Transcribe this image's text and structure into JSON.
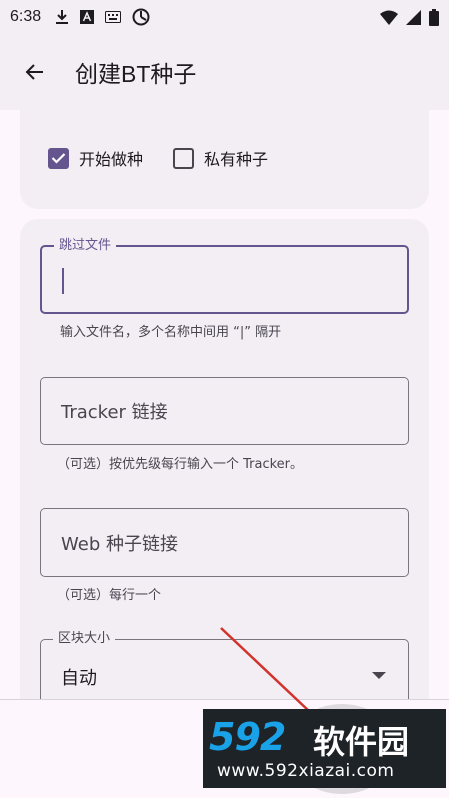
{
  "status_bar": {
    "time": "6:38",
    "left_icons": [
      "download-icon",
      "a-box-icon",
      "keyboard-icon",
      "data-saver-icon"
    ],
    "right_icons": [
      "wifi-icon",
      "signal-icon",
      "battery-icon"
    ]
  },
  "app_bar": {
    "title": "创建BT种子",
    "back_icon": "arrow-back-icon"
  },
  "options": {
    "start_seeding": {
      "label": "开始做种",
      "checked": true
    },
    "private_torrent": {
      "label": "私有种子",
      "checked": false
    }
  },
  "fields": {
    "skip_files": {
      "label": "跳过文件",
      "value": "",
      "helper": "输入文件名，多个名称中间用 “|” 隔开"
    },
    "tracker": {
      "placeholder": "Tracker 链接",
      "helper": "（可选）按优先级每行输入一个 Tracker。"
    },
    "web_seed": {
      "placeholder": "Web 种子链接",
      "helper": "（可选）每行一个"
    },
    "piece_size": {
      "label": "区块大小",
      "value": "自动"
    }
  },
  "watermark": {
    "logo": "592",
    "brand": "软件园",
    "url": "www.592xiazai.com"
  },
  "colors": {
    "accent": "#65558f",
    "surface": "#f3eef4",
    "background": "#fdf7fd",
    "annotation": "#d0342c"
  }
}
